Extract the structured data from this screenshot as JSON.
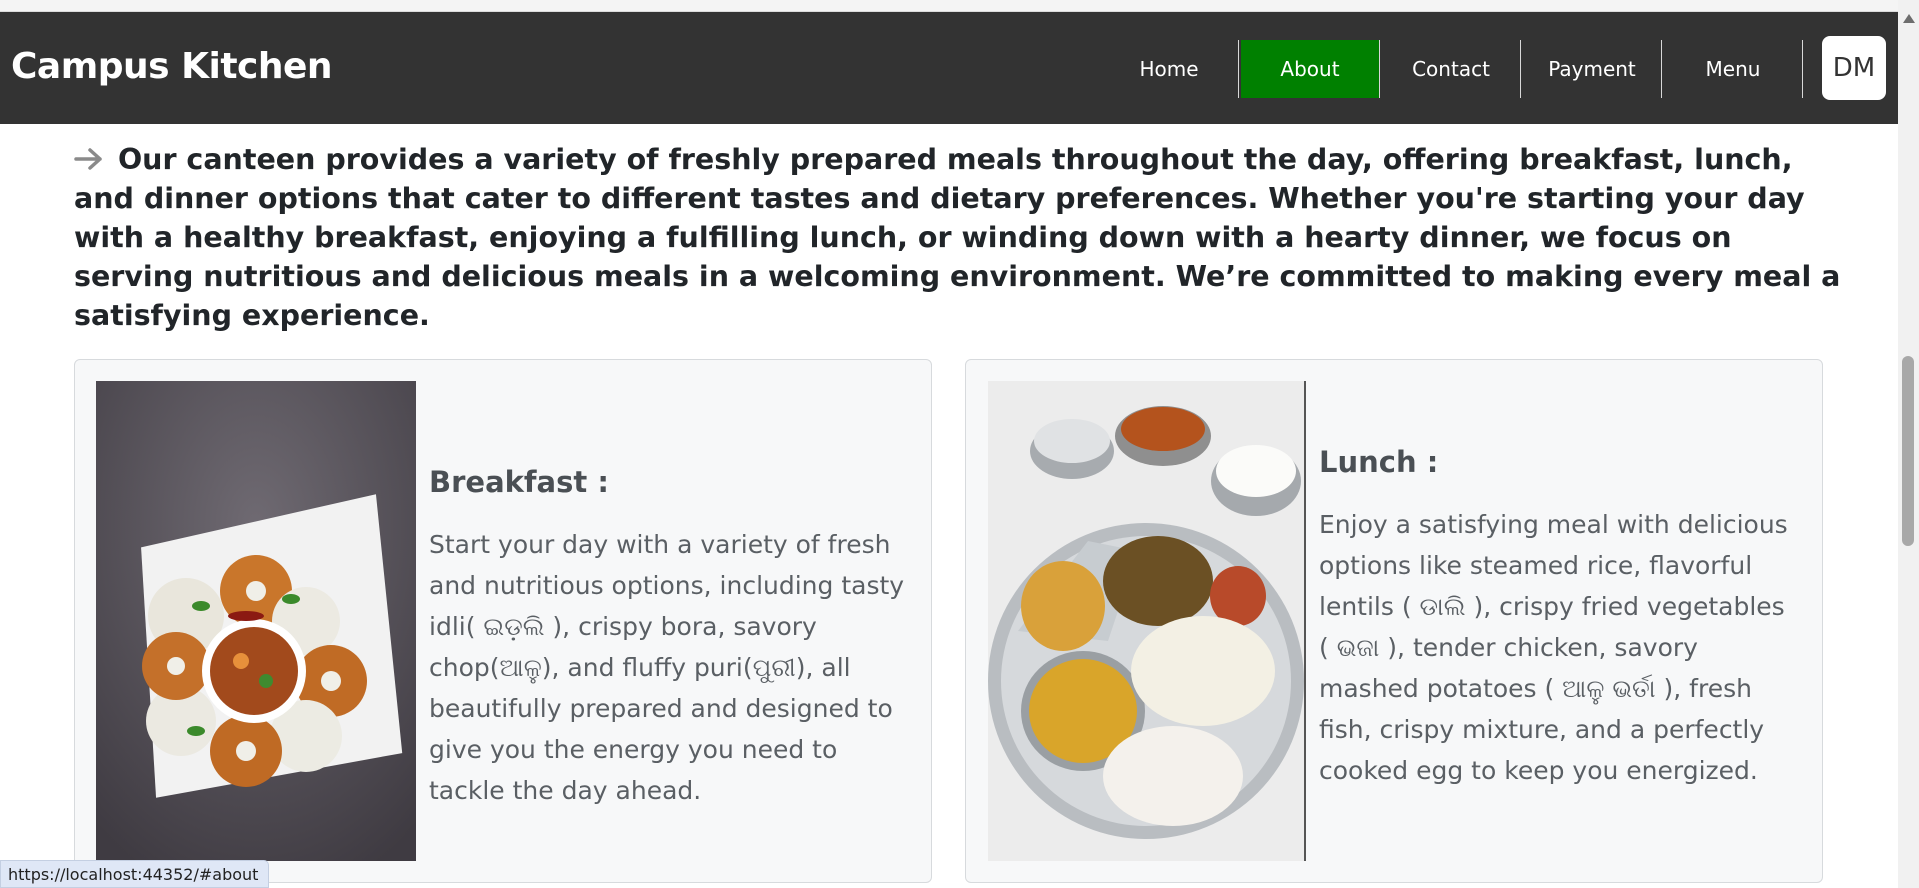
{
  "navbar": {
    "brand": "Campus Kitchen",
    "items": [
      {
        "label": "Home",
        "active": false
      },
      {
        "label": "About",
        "active": true
      },
      {
        "label": "Contact",
        "active": false
      },
      {
        "label": "Payment",
        "active": false
      },
      {
        "label": "Menu",
        "active": false
      }
    ],
    "avatar_initials": "DM"
  },
  "intro": {
    "arrow_icon": "arrow-right-icon",
    "text": "Our canteen provides a variety of freshly prepared meals throughout the day, offering breakfast, lunch, and dinner options that cater to different tastes and dietary preferences. Whether you're starting your day with a healthy breakfast, enjoying a fulfilling lunch, or winding down with a hearty dinner, we focus on serving nutritious and delicious meals in a welcoming environment. We’re committed to making every meal a satisfying experience."
  },
  "cards": [
    {
      "title": "Breakfast :",
      "text": "Start your day with a variety of fresh and nutritious options, including tasty idli( ଇଡ଼ଲି ), crispy bora, savory chop(ଆଳୁ), and fluffy puri(ପୁରୀ), all beautifully prepared and designed to give you the energy you need to tackle the day ahead."
    },
    {
      "title": "Lunch :",
      "text": "Enjoy a satisfying meal with delicious options like steamed rice, flavorful lentils ( ଡାଲି ), crispy fried vegetables ( ଭଜା ), tender chicken, savory mashed potatoes ( ଆଳୁ ଭର୍ତା ), fresh fish, crispy mixture, and a perfectly cooked egg to keep you energized."
    }
  ],
  "status_bar": {
    "url": "https://localhost:44352/#about"
  },
  "colors": {
    "navbar_bg": "#333333",
    "active_nav": "#008000",
    "card_bg": "#f7f8f9"
  }
}
